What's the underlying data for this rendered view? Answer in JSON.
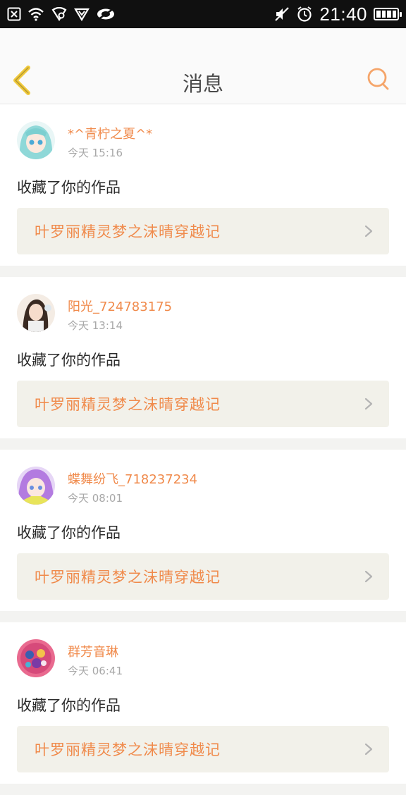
{
  "status_bar": {
    "time": "21:40",
    "left_icons": [
      "notification-dismiss-icon",
      "wifi-icon",
      "signal-icon",
      "shield-icon",
      "eye-icon"
    ],
    "right_icons": [
      "mute-icon",
      "alarm-icon",
      "battery-icon"
    ]
  },
  "header": {
    "title": "消息",
    "back_icon": "chevron-left-icon",
    "search_icon": "search-icon",
    "accent": "#f08a4b"
  },
  "messages": [
    {
      "username": "*^青柠之夏^*",
      "time": "今天 15:16",
      "action": "收藏了你的作品",
      "work_title": "叶罗丽精灵梦之沫晴穿越记",
      "avatar_color": "#8fd8d8"
    },
    {
      "username": "阳光_724783175",
      "time": "今天 13:14",
      "action": "收藏了你的作品",
      "work_title": "叶罗丽精灵梦之沫晴穿越记",
      "avatar_color": "#e8c9b6"
    },
    {
      "username": "蝶舞纷飞_718237234",
      "time": "今天 08:01",
      "action": "收藏了你的作品",
      "work_title": "叶罗丽精灵梦之沫晴穿越记",
      "avatar_color": "#b37be0"
    },
    {
      "username": "群芳音琳",
      "time": "今天 06:41",
      "action": "收藏了你的作品",
      "work_title": "叶罗丽精灵梦之沫晴穿越记",
      "avatar_color": "#d64a7a"
    }
  ]
}
